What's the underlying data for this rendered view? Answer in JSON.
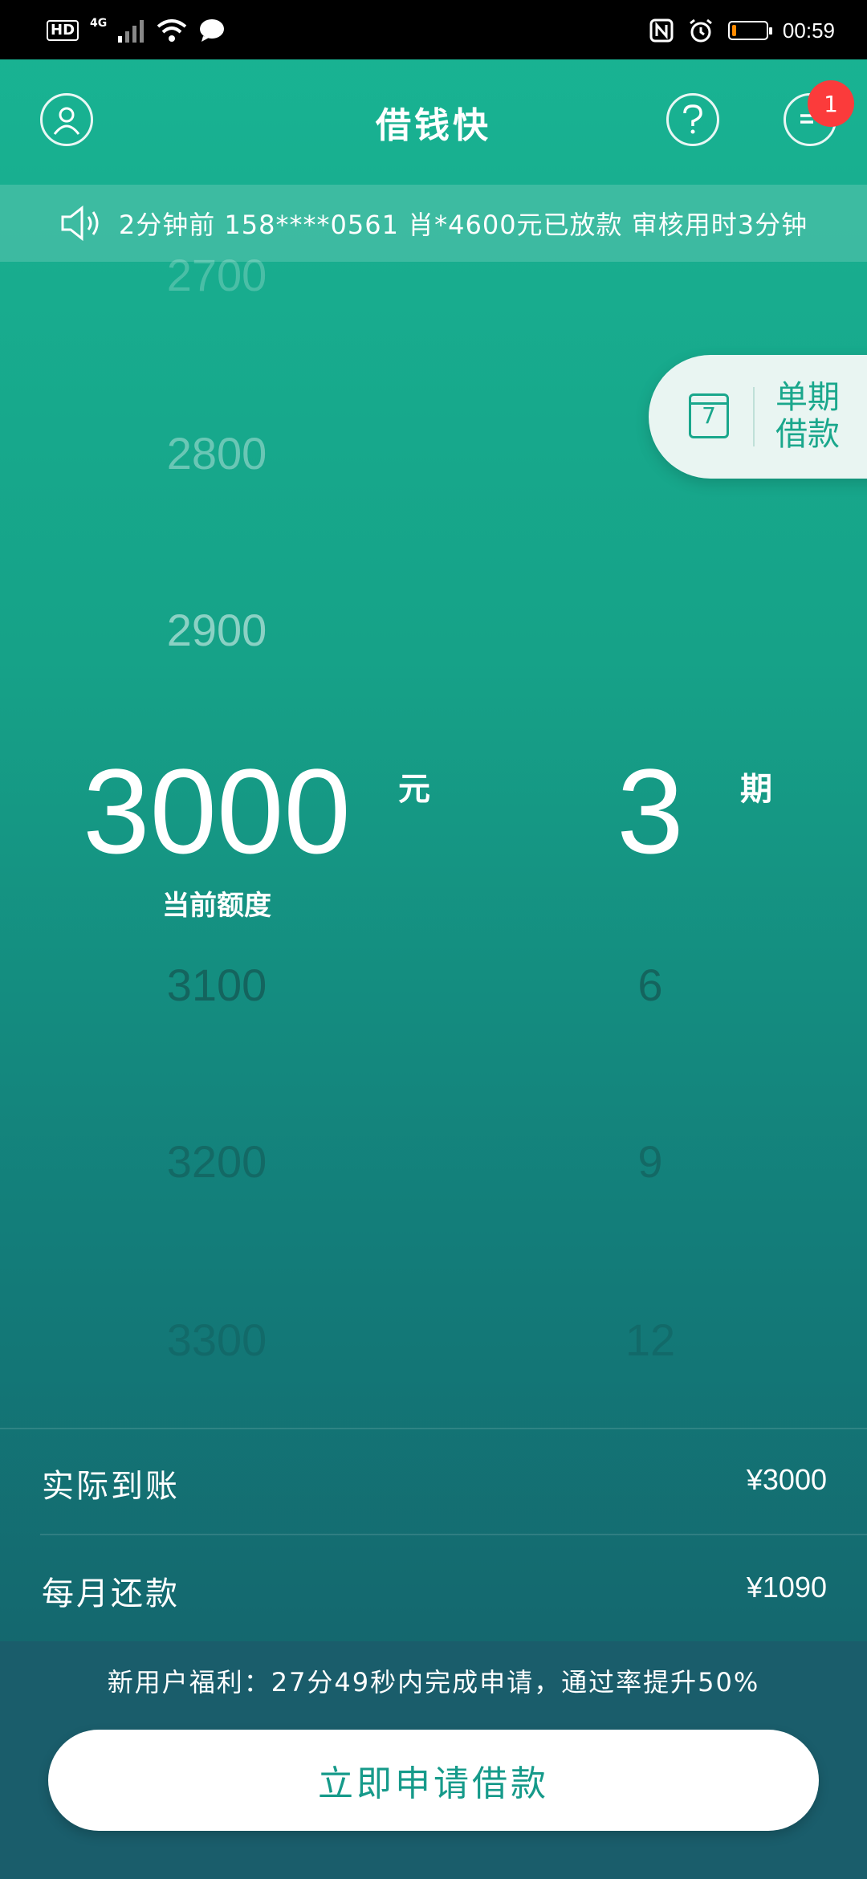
{
  "status_bar": {
    "network_hd": "HD",
    "network_type": "4G",
    "time": "00:59",
    "battery_level_pct": 12
  },
  "header": {
    "title": "借钱快",
    "message_badge_count": "1"
  },
  "notice": {
    "text": "2分钟前 158****0561 肖*4600元已放款 审核用时3分钟"
  },
  "single_period": {
    "calendar_day": "7",
    "label_line1": "单期",
    "label_line2": "借款"
  },
  "amount_picker": {
    "options_above": [
      "2700",
      "2800",
      "2900"
    ],
    "selected": "3000",
    "unit": "元",
    "options_below": [
      "3100",
      "3200",
      "3300"
    ],
    "selected_label": "当前额度"
  },
  "term_picker": {
    "selected": "3",
    "unit": "期",
    "options_below": [
      "6",
      "9",
      "12"
    ]
  },
  "summary": {
    "actual_label": "实际到账",
    "actual_value": "¥3000",
    "monthly_label": "每月还款",
    "monthly_value": "¥1090"
  },
  "promo": {
    "text": "新用户福利：27分49秒内完成申请，通过率提升50%"
  },
  "apply_button": {
    "label": "立即申请借款"
  }
}
